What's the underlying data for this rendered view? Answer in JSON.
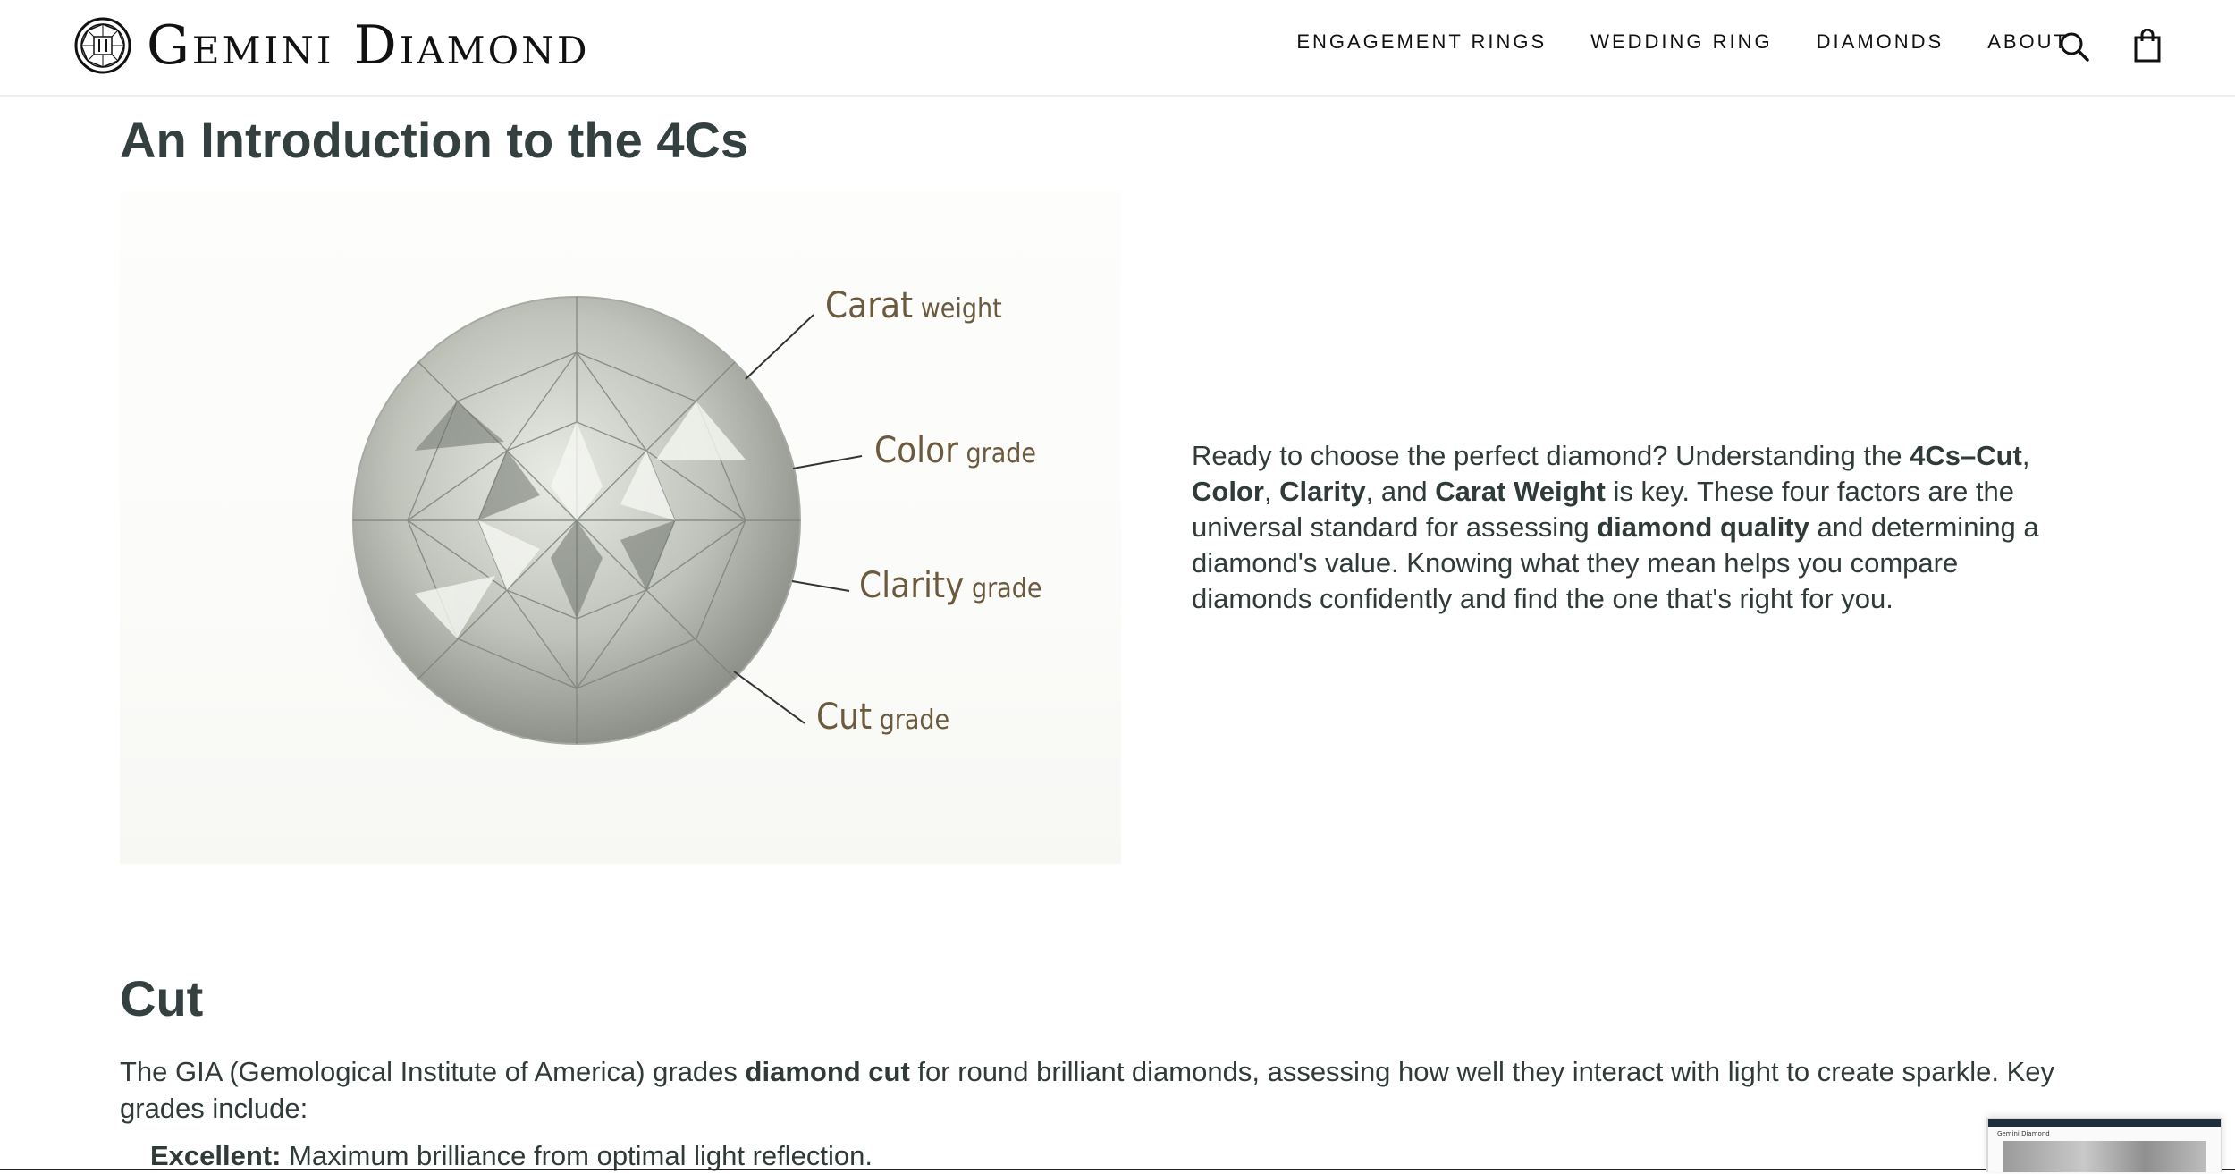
{
  "header": {
    "brand": "Gemini Diamond",
    "nav": [
      "ENGAGEMENT RINGS",
      "WEDDING RING",
      "DIAMONDS",
      "ABOUT"
    ],
    "icons": [
      "search-icon",
      "shopping-bag-icon"
    ]
  },
  "intro": {
    "title": "An Introduction to the 4Cs",
    "callouts": [
      {
        "big": "Carat",
        "small": " weight"
      },
      {
        "big": "Color",
        "small": " grade"
      },
      {
        "big": "Clarity",
        "small": " grade"
      },
      {
        "big": "Cut",
        "small": " grade"
      }
    ],
    "paragraph": [
      {
        "text": "Ready to choose the perfect diamond? Understanding the ",
        "bold": false
      },
      {
        "text": "4Cs–Cut",
        "bold": true
      },
      {
        "text": ", ",
        "bold": false
      },
      {
        "text": "Color",
        "bold": true
      },
      {
        "text": ", ",
        "bold": false
      },
      {
        "text": "Clarity",
        "bold": true
      },
      {
        "text": ", and ",
        "bold": false
      },
      {
        "text": "Carat Weight",
        "bold": true
      },
      {
        "text": " is key. These four factors are the universal standard for assessing ",
        "bold": false
      },
      {
        "text": "diamond quality",
        "bold": true
      },
      {
        "text": " and determining a diamond's value. Knowing what they mean helps you compare diamonds confidently and find the one that's right for you.",
        "bold": false
      }
    ]
  },
  "cut": {
    "title": "Cut",
    "description": [
      {
        "text": "The GIA (Gemological Institute of America) grades ",
        "bold": false
      },
      {
        "text": "diamond cut",
        "bold": true
      },
      {
        "text": " for round brilliant diamonds, assessing how well they interact with light to create sparkle. Key grades include:",
        "bold": false
      }
    ],
    "grades": [
      {
        "label": "Excellent:",
        "text": " Maximum brilliance from optimal light reflection."
      }
    ]
  },
  "thumbnail": {
    "label": "Gemini Diamond"
  },
  "colors": {
    "heading": "#33403f",
    "text": "#2f3a39",
    "callout": "#6b5a3e"
  }
}
